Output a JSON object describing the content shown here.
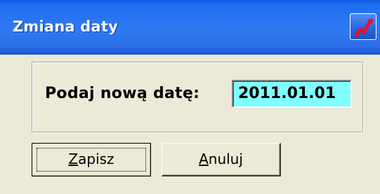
{
  "window": {
    "title": "Zmiana daty"
  },
  "form": {
    "prompt_label": "Podaj nową datę:",
    "date_value": "2011.01.01"
  },
  "buttons": {
    "save": {
      "mnemonic": "Z",
      "rest": "apisz"
    },
    "cancel": {
      "mnemonic": "A",
      "rest": "nuluj"
    }
  },
  "icons": {
    "titlebar_button": "red-zigzag-icon"
  },
  "colors": {
    "titlebar": "#2b76f3",
    "date_field_bg": "#80ffff",
    "dialog_bg": "#ece9d8",
    "icon_red": "#e8102a"
  }
}
